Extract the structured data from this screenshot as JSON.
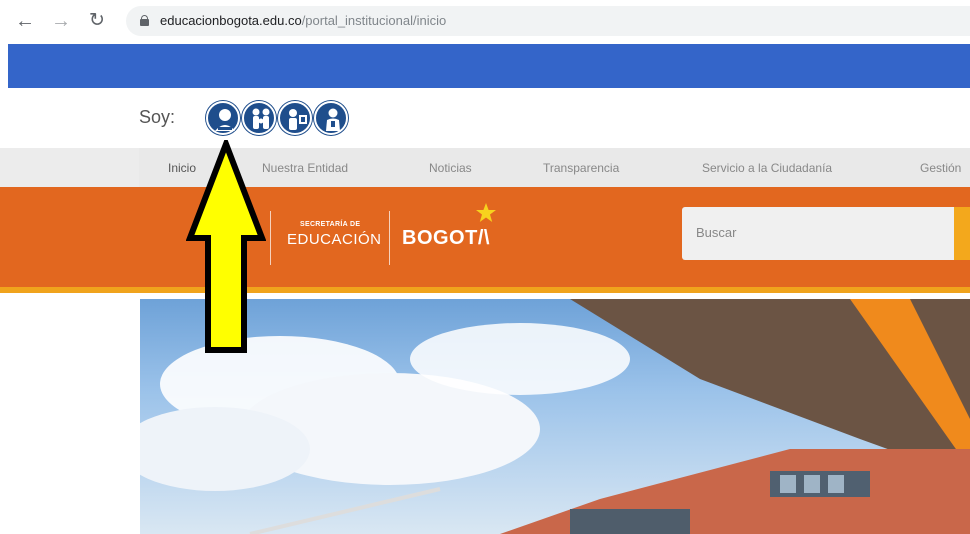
{
  "browser": {
    "url_host": "educacionbogota.edu.co",
    "url_path": "/portal_institucional/inicio",
    "icons": [
      "back-arrow-icon",
      "forward-arrow-icon",
      "reload-icon",
      "lock-icon"
    ]
  },
  "profile_selector": {
    "label": "Soy:",
    "icons": [
      "student-icon",
      "parent-icon",
      "teacher-icon",
      "citizen-icon"
    ]
  },
  "menu": {
    "items": [
      "Inicio",
      "Nuestra Entidad",
      "Noticias",
      "Transparencia",
      "Servicio a la Ciudadanía",
      "Gestión"
    ]
  },
  "banner": {
    "secretaria": "SECRETARÍA DE",
    "educacion": "EDUCACIÓN",
    "bogota": "BOGOT/\\",
    "search_placeholder": "Buscar",
    "colors": {
      "orange": "#e2671f",
      "accent": "#f3a81c",
      "blue": "#3465c9"
    }
  },
  "annotation": {
    "type": "arrow",
    "color": "#ffff00",
    "points_to": "student-icon"
  }
}
